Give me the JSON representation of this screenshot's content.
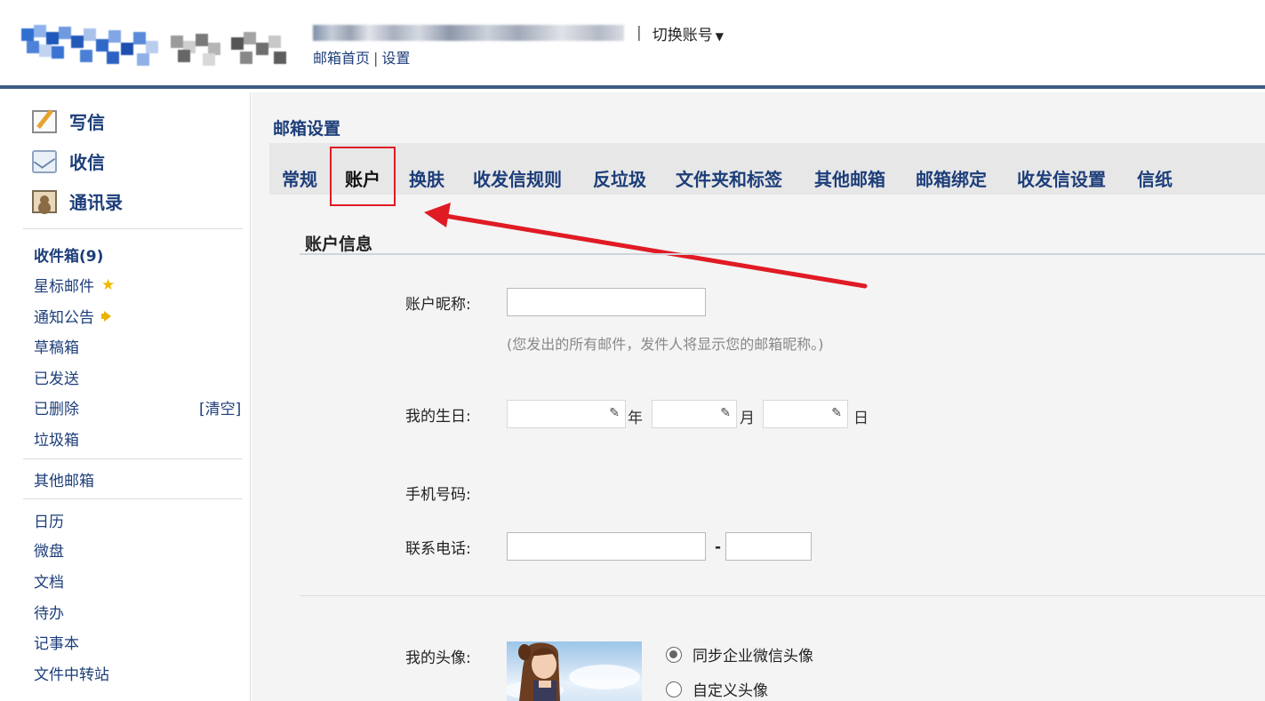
{
  "header": {
    "switch_account": "切换账号",
    "links": {
      "home": "邮箱首页",
      "separator": "|",
      "settings": "设置"
    },
    "account_separator": "|"
  },
  "sidebar": {
    "primary": [
      {
        "label": "写信",
        "icon": "compose-icon"
      },
      {
        "label": "收信",
        "icon": "inbox-icon"
      },
      {
        "label": "通讯录",
        "icon": "contacts-icon"
      }
    ],
    "folders": [
      {
        "label": "收件箱(9)"
      },
      {
        "label": "星标邮件"
      },
      {
        "label": "通知公告"
      },
      {
        "label": "草稿箱"
      },
      {
        "label": "已发送"
      },
      {
        "label": "已删除"
      },
      {
        "label": "垃圾箱"
      }
    ],
    "clear_label": "[清空]",
    "other_mailbox": "其他邮箱",
    "apps": [
      {
        "label": "日历"
      },
      {
        "label": "微盘"
      },
      {
        "label": "文档"
      },
      {
        "label": "待办"
      },
      {
        "label": "记事本"
      },
      {
        "label": "文件中转站"
      }
    ]
  },
  "main": {
    "title": "邮箱设置",
    "tabs": [
      {
        "label": "常规"
      },
      {
        "label": "账户"
      },
      {
        "label": "换肤"
      },
      {
        "label": "收发信规则"
      },
      {
        "label": "反垃圾"
      },
      {
        "label": "文件夹和标签"
      },
      {
        "label": "其他邮箱"
      },
      {
        "label": "邮箱绑定"
      },
      {
        "label": "收发信设置"
      },
      {
        "label": "信纸"
      }
    ],
    "active_tab": "账户",
    "section_title": "账户信息",
    "nickname": {
      "label": "账户昵称:",
      "value": "",
      "hint": "(您发出的所有邮件，发件人将显示您的邮箱昵称。)"
    },
    "birthday": {
      "label": "我的生日:",
      "year_unit": "年",
      "month_unit": "月",
      "day_unit": "日"
    },
    "mobile": {
      "label": "手机号码:",
      "value": ""
    },
    "contact_phone": {
      "label": "联系电话:",
      "separator": "-"
    },
    "avatar": {
      "label": "我的头像:",
      "options": [
        {
          "label": "同步企业微信头像",
          "selected": true
        },
        {
          "label": "自定义头像",
          "selected": false
        }
      ]
    }
  },
  "colors": {
    "brand_blue": "#1d3e7a",
    "header_bar": "#3e5c82",
    "annotation_red": "#e01b24"
  }
}
